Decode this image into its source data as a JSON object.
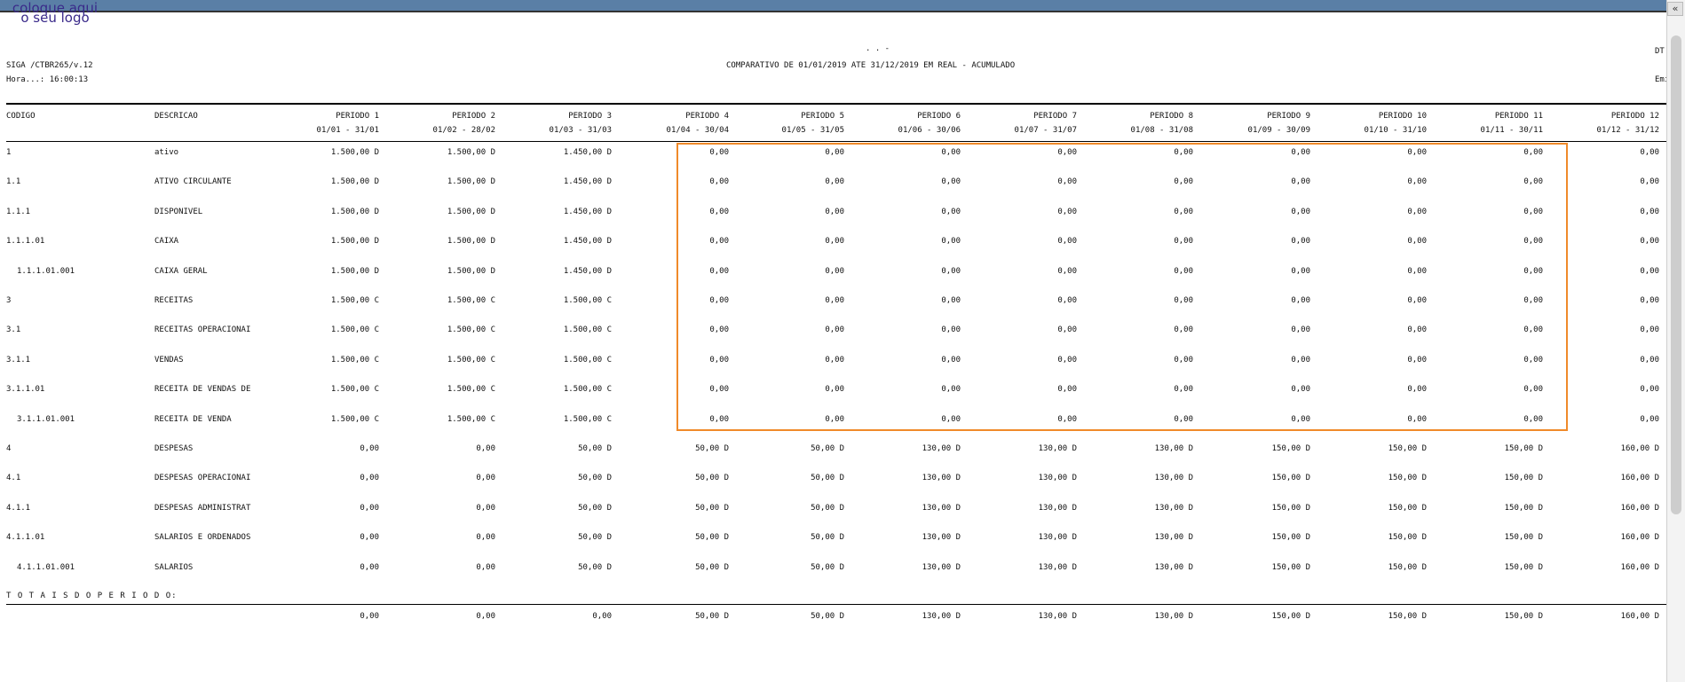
{
  "header": {
    "logo_line1": "coloque aqui",
    "logo_line2": "o seu logo",
    "marks": ". .  -",
    "program": "SIGA /CTBR265/v.12",
    "time": "Hora...: 16:00:13",
    "title": "COMPARATIVO DE 01/01/2019 ATE 31/12/2019 EM REAL - ACUMULADO",
    "right_top": "DT.I",
    "right_bottom": "Emis"
  },
  "columns": {
    "codigo": "CODIGO",
    "descricao": "DESCRICAO",
    "periods": [
      {
        "label": "PERIODO 1",
        "range": "01/01 - 31/01"
      },
      {
        "label": "PERIODO 2",
        "range": "01/02 - 28/02"
      },
      {
        "label": "PERIODO 3",
        "range": "01/03 - 31/03"
      },
      {
        "label": "PERIODO 4",
        "range": "01/04 - 30/04"
      },
      {
        "label": "PERIODO 5",
        "range": "01/05 - 31/05"
      },
      {
        "label": "PERIODO 6",
        "range": "01/06 - 30/06"
      },
      {
        "label": "PERIODO 7",
        "range": "01/07 - 31/07"
      },
      {
        "label": "PERIODO 8",
        "range": "01/08 - 31/08"
      },
      {
        "label": "PERIODO 9",
        "range": "01/09 - 30/09"
      },
      {
        "label": "PERIODO 10",
        "range": "01/10 - 31/10"
      },
      {
        "label": "PERIODO 11",
        "range": "01/11 - 30/11"
      },
      {
        "label": "PERIODO 12",
        "range": "01/12 - 31/12"
      }
    ]
  },
  "rows": [
    {
      "code": "1",
      "desc": "ativo",
      "values": [
        "1.500,00 D",
        "1.500,00 D",
        "1.450,00 D",
        "0,00",
        "0,00",
        "0,00",
        "0,00",
        "0,00",
        "0,00",
        "0,00",
        "0,00",
        "0,00"
      ]
    },
    {
      "code": "1.1",
      "desc": "ATIVO CIRCULANTE",
      "values": [
        "1.500,00 D",
        "1.500,00 D",
        "1.450,00 D",
        "0,00",
        "0,00",
        "0,00",
        "0,00",
        "0,00",
        "0,00",
        "0,00",
        "0,00",
        "0,00"
      ]
    },
    {
      "code": "1.1.1",
      "desc": "DISPONIVEL",
      "values": [
        "1.500,00 D",
        "1.500,00 D",
        "1.450,00 D",
        "0,00",
        "0,00",
        "0,00",
        "0,00",
        "0,00",
        "0,00",
        "0,00",
        "0,00",
        "0,00"
      ]
    },
    {
      "code": "1.1.1.01",
      "desc": "CAIXA",
      "values": [
        "1.500,00 D",
        "1.500,00 D",
        "1.450,00 D",
        "0,00",
        "0,00",
        "0,00",
        "0,00",
        "0,00",
        "0,00",
        "0,00",
        "0,00",
        "0,00"
      ]
    },
    {
      "code": "1.1.1.01.001",
      "desc": "CAIXA GERAL",
      "values": [
        "1.500,00 D",
        "1.500,00 D",
        "1.450,00 D",
        "0,00",
        "0,00",
        "0,00",
        "0,00",
        "0,00",
        "0,00",
        "0,00",
        "0,00",
        "0,00"
      ]
    },
    {
      "code": "3",
      "desc": "RECEITAS",
      "values": [
        "1.500,00 C",
        "1.500,00 C",
        "1.500,00 C",
        "0,00",
        "0,00",
        "0,00",
        "0,00",
        "0,00",
        "0,00",
        "0,00",
        "0,00",
        "0,00"
      ]
    },
    {
      "code": "3.1",
      "desc": "RECEITAS OPERACIONAI",
      "values": [
        "1.500,00 C",
        "1.500,00 C",
        "1.500,00 C",
        "0,00",
        "0,00",
        "0,00",
        "0,00",
        "0,00",
        "0,00",
        "0,00",
        "0,00",
        "0,00"
      ]
    },
    {
      "code": "3.1.1",
      "desc": "VENDAS",
      "values": [
        "1.500,00 C",
        "1.500,00 C",
        "1.500,00 C",
        "0,00",
        "0,00",
        "0,00",
        "0,00",
        "0,00",
        "0,00",
        "0,00",
        "0,00",
        "0,00"
      ]
    },
    {
      "code": "3.1.1.01",
      "desc": "RECEITA DE VENDAS DE",
      "values": [
        "1.500,00 C",
        "1.500,00 C",
        "1.500,00 C",
        "0,00",
        "0,00",
        "0,00",
        "0,00",
        "0,00",
        "0,00",
        "0,00",
        "0,00",
        "0,00"
      ]
    },
    {
      "code": "3.1.1.01.001",
      "desc": "RECEITA DE VENDA",
      "values": [
        "1.500,00 C",
        "1.500,00 C",
        "1.500,00 C",
        "0,00",
        "0,00",
        "0,00",
        "0,00",
        "0,00",
        "0,00",
        "0,00",
        "0,00",
        "0,00"
      ]
    },
    {
      "code": "4",
      "desc": "DESPESAS",
      "values": [
        "0,00",
        "0,00",
        "50,00 D",
        "50,00 D",
        "50,00 D",
        "130,00 D",
        "130,00 D",
        "130,00 D",
        "150,00 D",
        "150,00 D",
        "150,00 D",
        "160,00 D"
      ]
    },
    {
      "code": "4.1",
      "desc": "DESPESAS OPERACIONAI",
      "values": [
        "0,00",
        "0,00",
        "50,00 D",
        "50,00 D",
        "50,00 D",
        "130,00 D",
        "130,00 D",
        "130,00 D",
        "150,00 D",
        "150,00 D",
        "150,00 D",
        "160,00 D"
      ]
    },
    {
      "code": "4.1.1",
      "desc": "DESPESAS ADMINISTRAT",
      "values": [
        "0,00",
        "0,00",
        "50,00 D",
        "50,00 D",
        "50,00 D",
        "130,00 D",
        "130,00 D",
        "130,00 D",
        "150,00 D",
        "150,00 D",
        "150,00 D",
        "160,00 D"
      ]
    },
    {
      "code": "4.1.1.01",
      "desc": "SALARIOS E ORDENADOS",
      "values": [
        "0,00",
        "0,00",
        "50,00 D",
        "50,00 D",
        "50,00 D",
        "130,00 D",
        "130,00 D",
        "130,00 D",
        "150,00 D",
        "150,00 D",
        "150,00 D",
        "160,00 D"
      ]
    },
    {
      "code": "4.1.1.01.001",
      "desc": "SALARIOS",
      "values": [
        "0,00",
        "0,00",
        "50,00 D",
        "50,00 D",
        "50,00 D",
        "130,00 D",
        "130,00 D",
        "130,00 D",
        "150,00 D",
        "150,00 D",
        "150,00 D",
        "160,00 D"
      ]
    }
  ],
  "totals": {
    "label": "T O T A I S   D O   P E R I O D O:",
    "values": [
      "0,00",
      "0,00",
      "0,00",
      "50,00 D",
      "50,00 D",
      "130,00 D",
      "130,00 D",
      "130,00 D",
      "150,00 D",
      "150,00 D",
      "150,00 D",
      "160,00 D"
    ]
  },
  "colors": {
    "highlight": "#f08a2a",
    "logo": "#3a2a8a"
  }
}
